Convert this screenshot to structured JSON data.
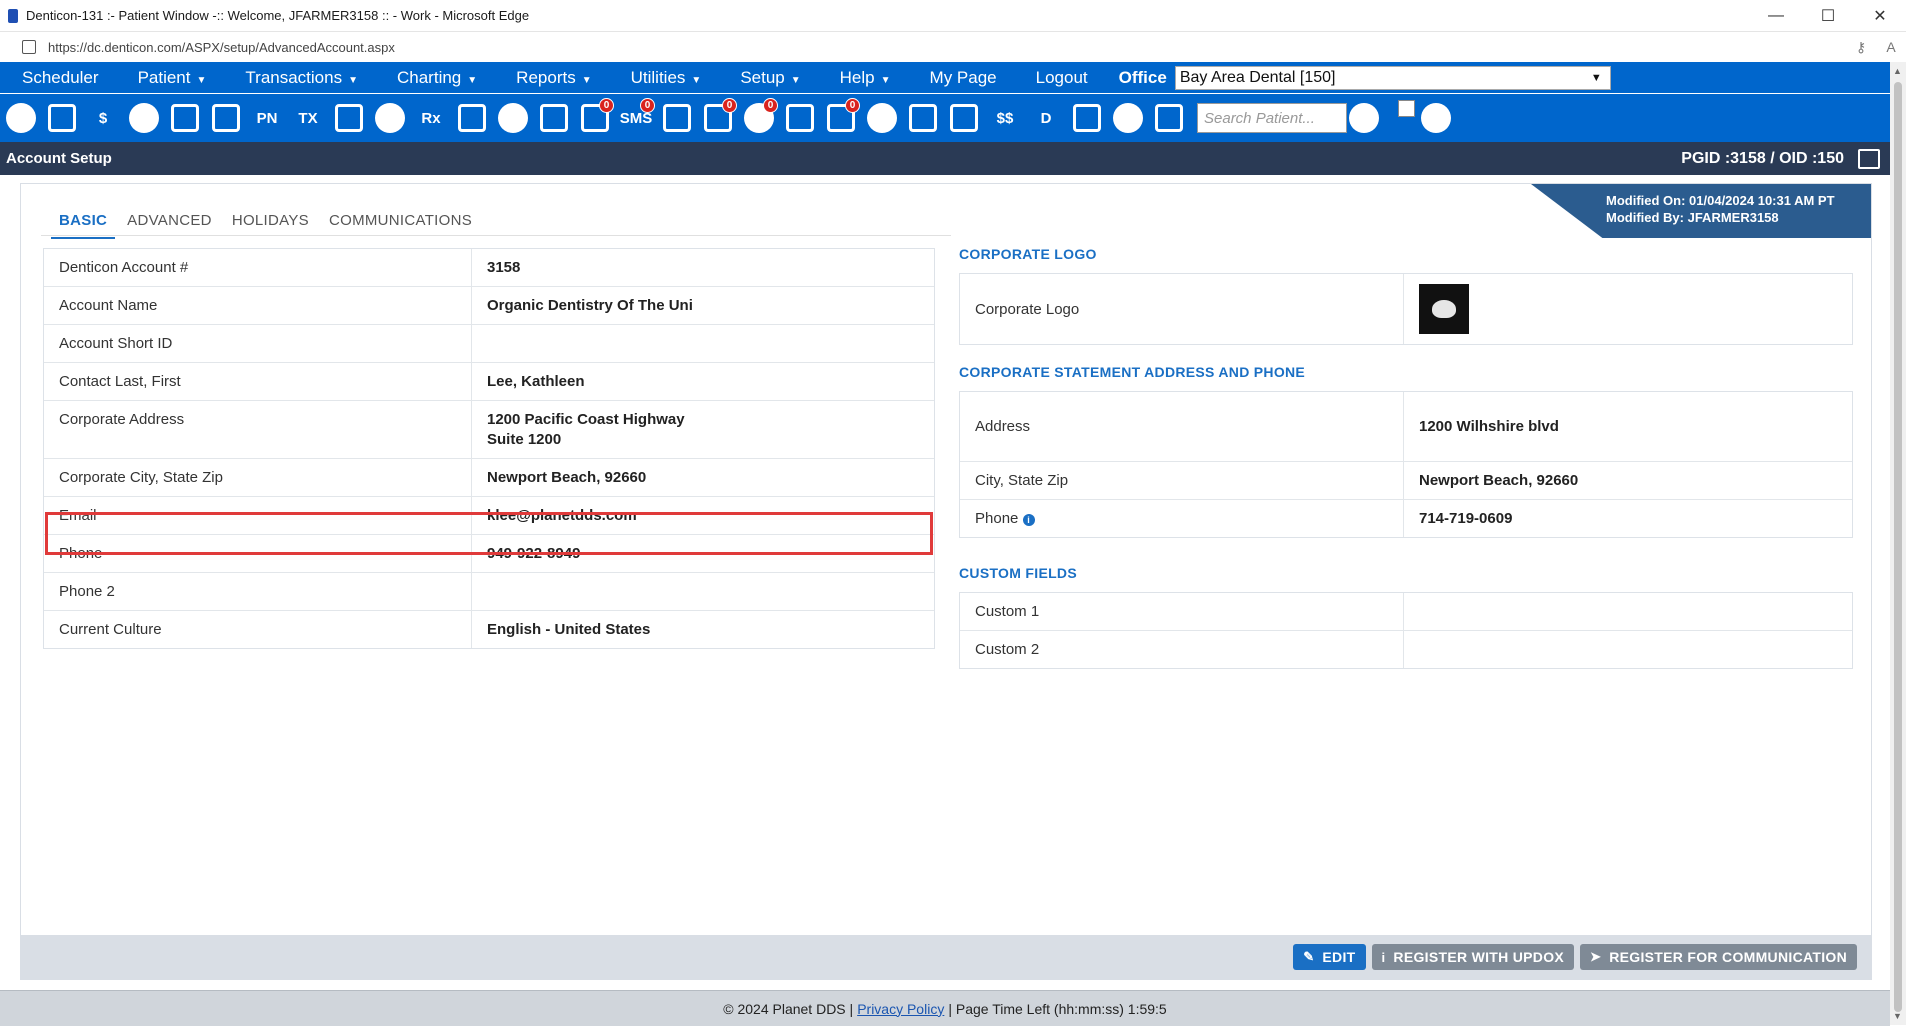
{
  "window": {
    "title": "Denticon-131 :- Patient Window -:: Welcome, JFARMER3158 :: - Work - Microsoft Edge",
    "url": "https://dc.denticon.com/ASPX/setup/AdvancedAccount.aspx"
  },
  "menu": {
    "items": [
      {
        "label": "Scheduler",
        "caret": false
      },
      {
        "label": "Patient",
        "caret": true
      },
      {
        "label": "Transactions",
        "caret": true
      },
      {
        "label": "Charting",
        "caret": true
      },
      {
        "label": "Reports",
        "caret": true
      },
      {
        "label": "Utilities",
        "caret": true
      },
      {
        "label": "Setup",
        "caret": true
      },
      {
        "label": "Help",
        "caret": true
      },
      {
        "label": "My Page",
        "caret": false
      },
      {
        "label": "Logout",
        "caret": false
      }
    ],
    "office_label": "Office",
    "office_value": "Bay Area Dental [150]"
  },
  "toolbar": {
    "icons": [
      {
        "name": "home-icon",
        "text": ""
      },
      {
        "name": "calendar-icon",
        "text": ""
      },
      {
        "name": "dollar-icon",
        "text": "$"
      },
      {
        "name": "clipboard-edit-icon",
        "text": ""
      },
      {
        "name": "tooth-icon",
        "text": ""
      },
      {
        "name": "teeth-chart-icon",
        "text": ""
      },
      {
        "name": "pn-icon",
        "text": "PN"
      },
      {
        "name": "tx-icon",
        "text": "TX"
      },
      {
        "name": "add-patient-icon",
        "text": ""
      },
      {
        "name": "add-family-icon",
        "text": ""
      },
      {
        "name": "rx-icon",
        "text": "Rx"
      },
      {
        "name": "notes-icon",
        "text": ""
      },
      {
        "name": "fax-icon",
        "text": ""
      },
      {
        "name": "email-icon",
        "text": ""
      },
      {
        "name": "messages-icon",
        "text": "",
        "badge": "0"
      },
      {
        "name": "sms-icon",
        "text": "SMS",
        "badge": "0"
      },
      {
        "name": "clock-icon",
        "text": ""
      },
      {
        "name": "global-settings-icon",
        "text": "",
        "badge": "0"
      },
      {
        "name": "support-icon",
        "text": "",
        "badge": "0"
      },
      {
        "name": "web-icon",
        "text": ""
      },
      {
        "name": "tasks-icon",
        "text": "",
        "badge": "0"
      },
      {
        "name": "group-icon",
        "text": ""
      },
      {
        "name": "printer-icon",
        "text": ""
      },
      {
        "name": "forward-icon",
        "text": ""
      },
      {
        "name": "insurance-icon",
        "text": "$$"
      },
      {
        "name": "document-icon",
        "text": "D"
      },
      {
        "name": "org-chart-icon",
        "text": ""
      },
      {
        "name": "analytics-icon",
        "text": ""
      },
      {
        "name": "collapse-icon",
        "text": ""
      }
    ],
    "search_placeholder": "Search Patient..."
  },
  "setup_bar": {
    "title": "Account Setup",
    "ids": "PGID :3158  /  OID :150"
  },
  "modified": {
    "on": "Modified On: 01/04/2024 10:31 AM PT",
    "by": "Modified By: JFARMER3158"
  },
  "tabs": [
    "BASIC",
    "ADVANCED",
    "HOLIDAYS",
    "COMMUNICATIONS"
  ],
  "account": {
    "rows": [
      {
        "label": "Denticon Account #",
        "value": "3158",
        "value2": ""
      },
      {
        "label": "Account Name",
        "value": "Organic Dentistry Of The Uni",
        "value2": ""
      },
      {
        "label": "Account Short ID",
        "value": "",
        "value2": ""
      },
      {
        "label": "Contact Last, First",
        "value": "Lee, Kathleen",
        "value2": ""
      },
      {
        "label": "Corporate Address",
        "value": "1200 Pacific Coast Highway",
        "value2": "Suite 1200"
      },
      {
        "label": "Corporate City, State Zip",
        "value": "Newport Beach, 92660",
        "value2": ""
      },
      {
        "label": "Email",
        "value": "klee@planetdds.com",
        "value2": ""
      },
      {
        "label": "Phone",
        "value": "949-922-8949",
        "value2": ""
      },
      {
        "label": "Phone 2",
        "value": "",
        "value2": ""
      },
      {
        "label": "Current Culture",
        "value": "English - United States",
        "value2": ""
      }
    ]
  },
  "corporate_logo": {
    "heading": "CORPORATE LOGO",
    "label": "Corporate Logo"
  },
  "corporate_statement": {
    "heading": "CORPORATE STATEMENT ADDRESS AND PHONE",
    "rows": [
      {
        "label": "Address",
        "value": "1200 Wilhshire blvd"
      },
      {
        "label": "City, State Zip",
        "value": "Newport Beach, 92660"
      },
      {
        "label": "Phone",
        "value": "714-719-0609"
      }
    ]
  },
  "custom_fields": {
    "heading": "CUSTOM FIELDS",
    "rows": [
      {
        "label": "Custom 1",
        "value": ""
      },
      {
        "label": "Custom 2",
        "value": ""
      }
    ]
  },
  "actions": {
    "edit": "EDIT",
    "register_updox": "REGISTER WITH UPDOX",
    "register_comm": "REGISTER FOR COMMUNICATION"
  },
  "footer": {
    "copyright": "© 2024 Planet DDS |",
    "privacy": "Privacy Policy",
    "time_left": "| Page Time Left (hh:mm:ss) 1:59:5"
  },
  "colors": {
    "brand_blue": "#0066cc",
    "header_dark": "#2a3a55",
    "highlight_red": "#e03a3a"
  }
}
